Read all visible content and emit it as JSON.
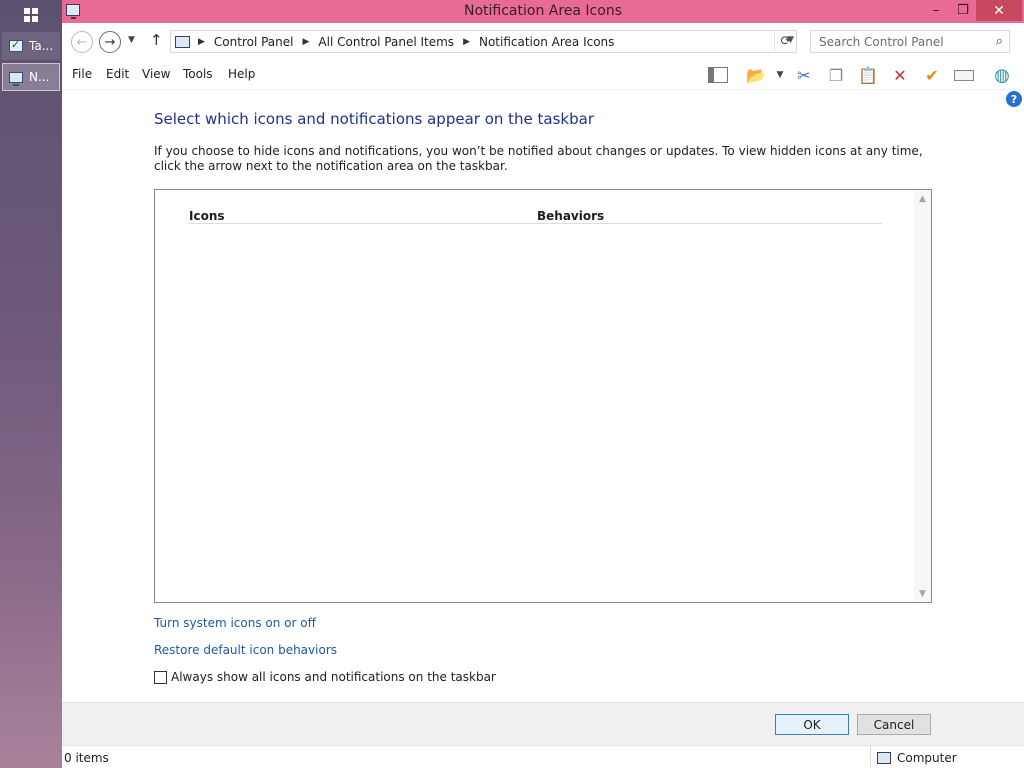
{
  "taskbar": {
    "items": [
      {
        "label": "Ta..."
      },
      {
        "label": "N..."
      }
    ]
  },
  "window": {
    "title": "Notification Area Icons",
    "controls": {
      "minimize": "–",
      "maximize": "❐",
      "close": "✕"
    }
  },
  "address": {
    "crumbs": [
      "Control Panel",
      "All Control Panel Items",
      "Notification Area Icons"
    ],
    "search_placeholder": "Search Control Panel"
  },
  "menu": {
    "items": [
      "File",
      "Edit",
      "View",
      "Tools",
      "Help"
    ]
  },
  "main": {
    "heading": "Select which icons and notifications appear on the taskbar",
    "description": "If you choose to hide icons and notifications, you won’t be notified about changes or updates. To view hidden icons at any time, click the arrow next to the notification area on the taskbar.",
    "columns": {
      "icons": "Icons",
      "behaviors": "Behaviors"
    },
    "links": {
      "system_icons": "Turn system icons on or off",
      "restore": "Restore default icon behaviors"
    },
    "always_show": {
      "label": "Always show all icons and notifications on the taskbar",
      "checked": false
    }
  },
  "buttons": {
    "ok": "OK",
    "cancel": "Cancel"
  },
  "status": {
    "items": "0 items",
    "location": "Computer"
  },
  "colors": {
    "titlebar": "#e86a96",
    "link": "#1e5aa0",
    "heading": "#1e3287"
  }
}
